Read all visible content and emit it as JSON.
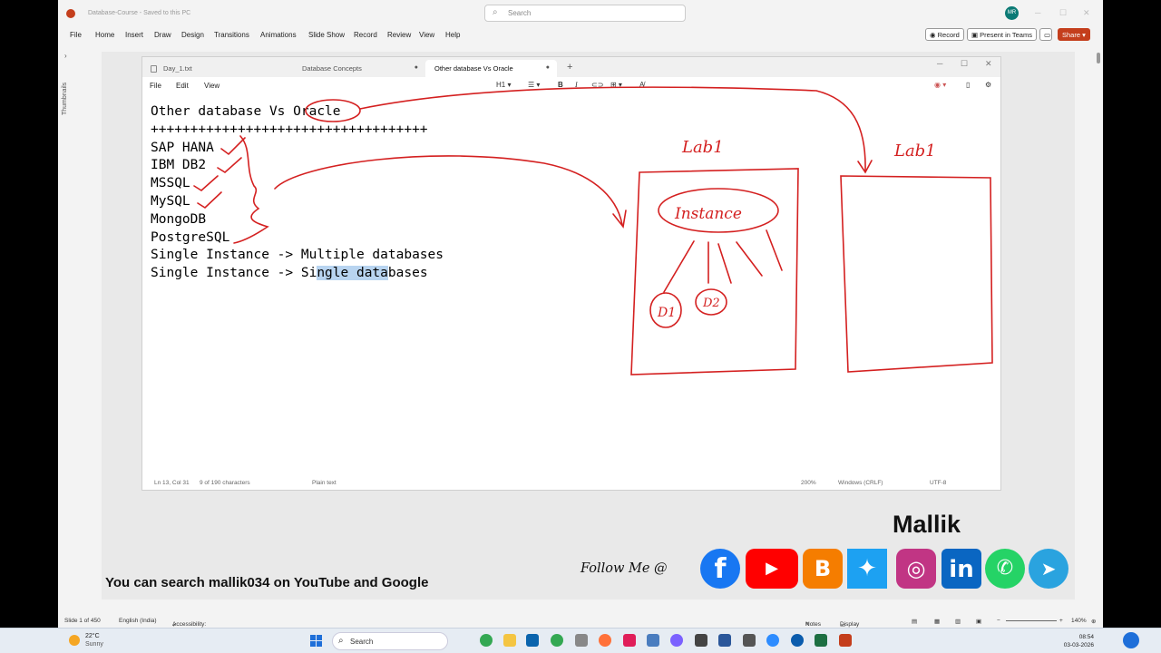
{
  "ppt": {
    "doc_title": "Database-Course  -  Saved to this PC",
    "search_placeholder": "Search",
    "avatar": "MR",
    "menu": [
      "File",
      "Home",
      "Insert",
      "Draw",
      "Design",
      "Transitions",
      "Animations",
      "Slide Show",
      "Record",
      "Review",
      "View",
      "Help"
    ],
    "record_label": "Record",
    "present_label": "Present in Teams",
    "share_label": "Share",
    "thumbnails_label": "Thumbnails"
  },
  "notepad": {
    "tabs": [
      "Day_1.txt",
      "Database Concepts",
      "Other database Vs Oracle"
    ],
    "menu": [
      "File",
      "Edit",
      "View"
    ],
    "heading_select": "H1",
    "lines": [
      "Other database Vs Oracle",
      "+++++++++++++++++++++++++++++++++++",
      "SAP HANA",
      "IBM DB2",
      "MSSQL",
      "MySQL",
      "MongoDB",
      "PostgreSQL",
      "",
      "Single Instance -> Multiple databases",
      "",
      "",
      "Single Instance -> Si"
    ],
    "hl_text": "ngle data",
    "hl_tail": "bases",
    "status": {
      "position": "Ln 13, Col 31",
      "chars": "9 of 190 characters",
      "mode": "Plain text",
      "zoom": "200%",
      "eol": "Windows (CRLF)",
      "encoding": "UTF-8"
    }
  },
  "ink": {
    "label_left": "Lab1",
    "label_right": "Lab1",
    "instance": "Instance",
    "db1": "D1",
    "db2": "D2",
    "color": "#d42020"
  },
  "overlay": {
    "brand": "Mallik",
    "search_line": "You can search mallik034 on YouTube and Google",
    "follow": "Follow Me @",
    "socials": [
      "facebook",
      "youtube",
      "blogger",
      "twitter",
      "instagram",
      "linkedin",
      "whatsapp",
      "telegram"
    ]
  },
  "ppt_status": {
    "slide": "Slide 1 of 450",
    "language": "English (India)",
    "accessibility": "Accessibility: Good to go",
    "notes": "Notes",
    "display": "Display Settings",
    "zoom": "140%"
  },
  "taskbar": {
    "temp": "22°C",
    "weather": "Sunny",
    "search": "Search",
    "time": "08:54",
    "date": "03-03-2026"
  }
}
